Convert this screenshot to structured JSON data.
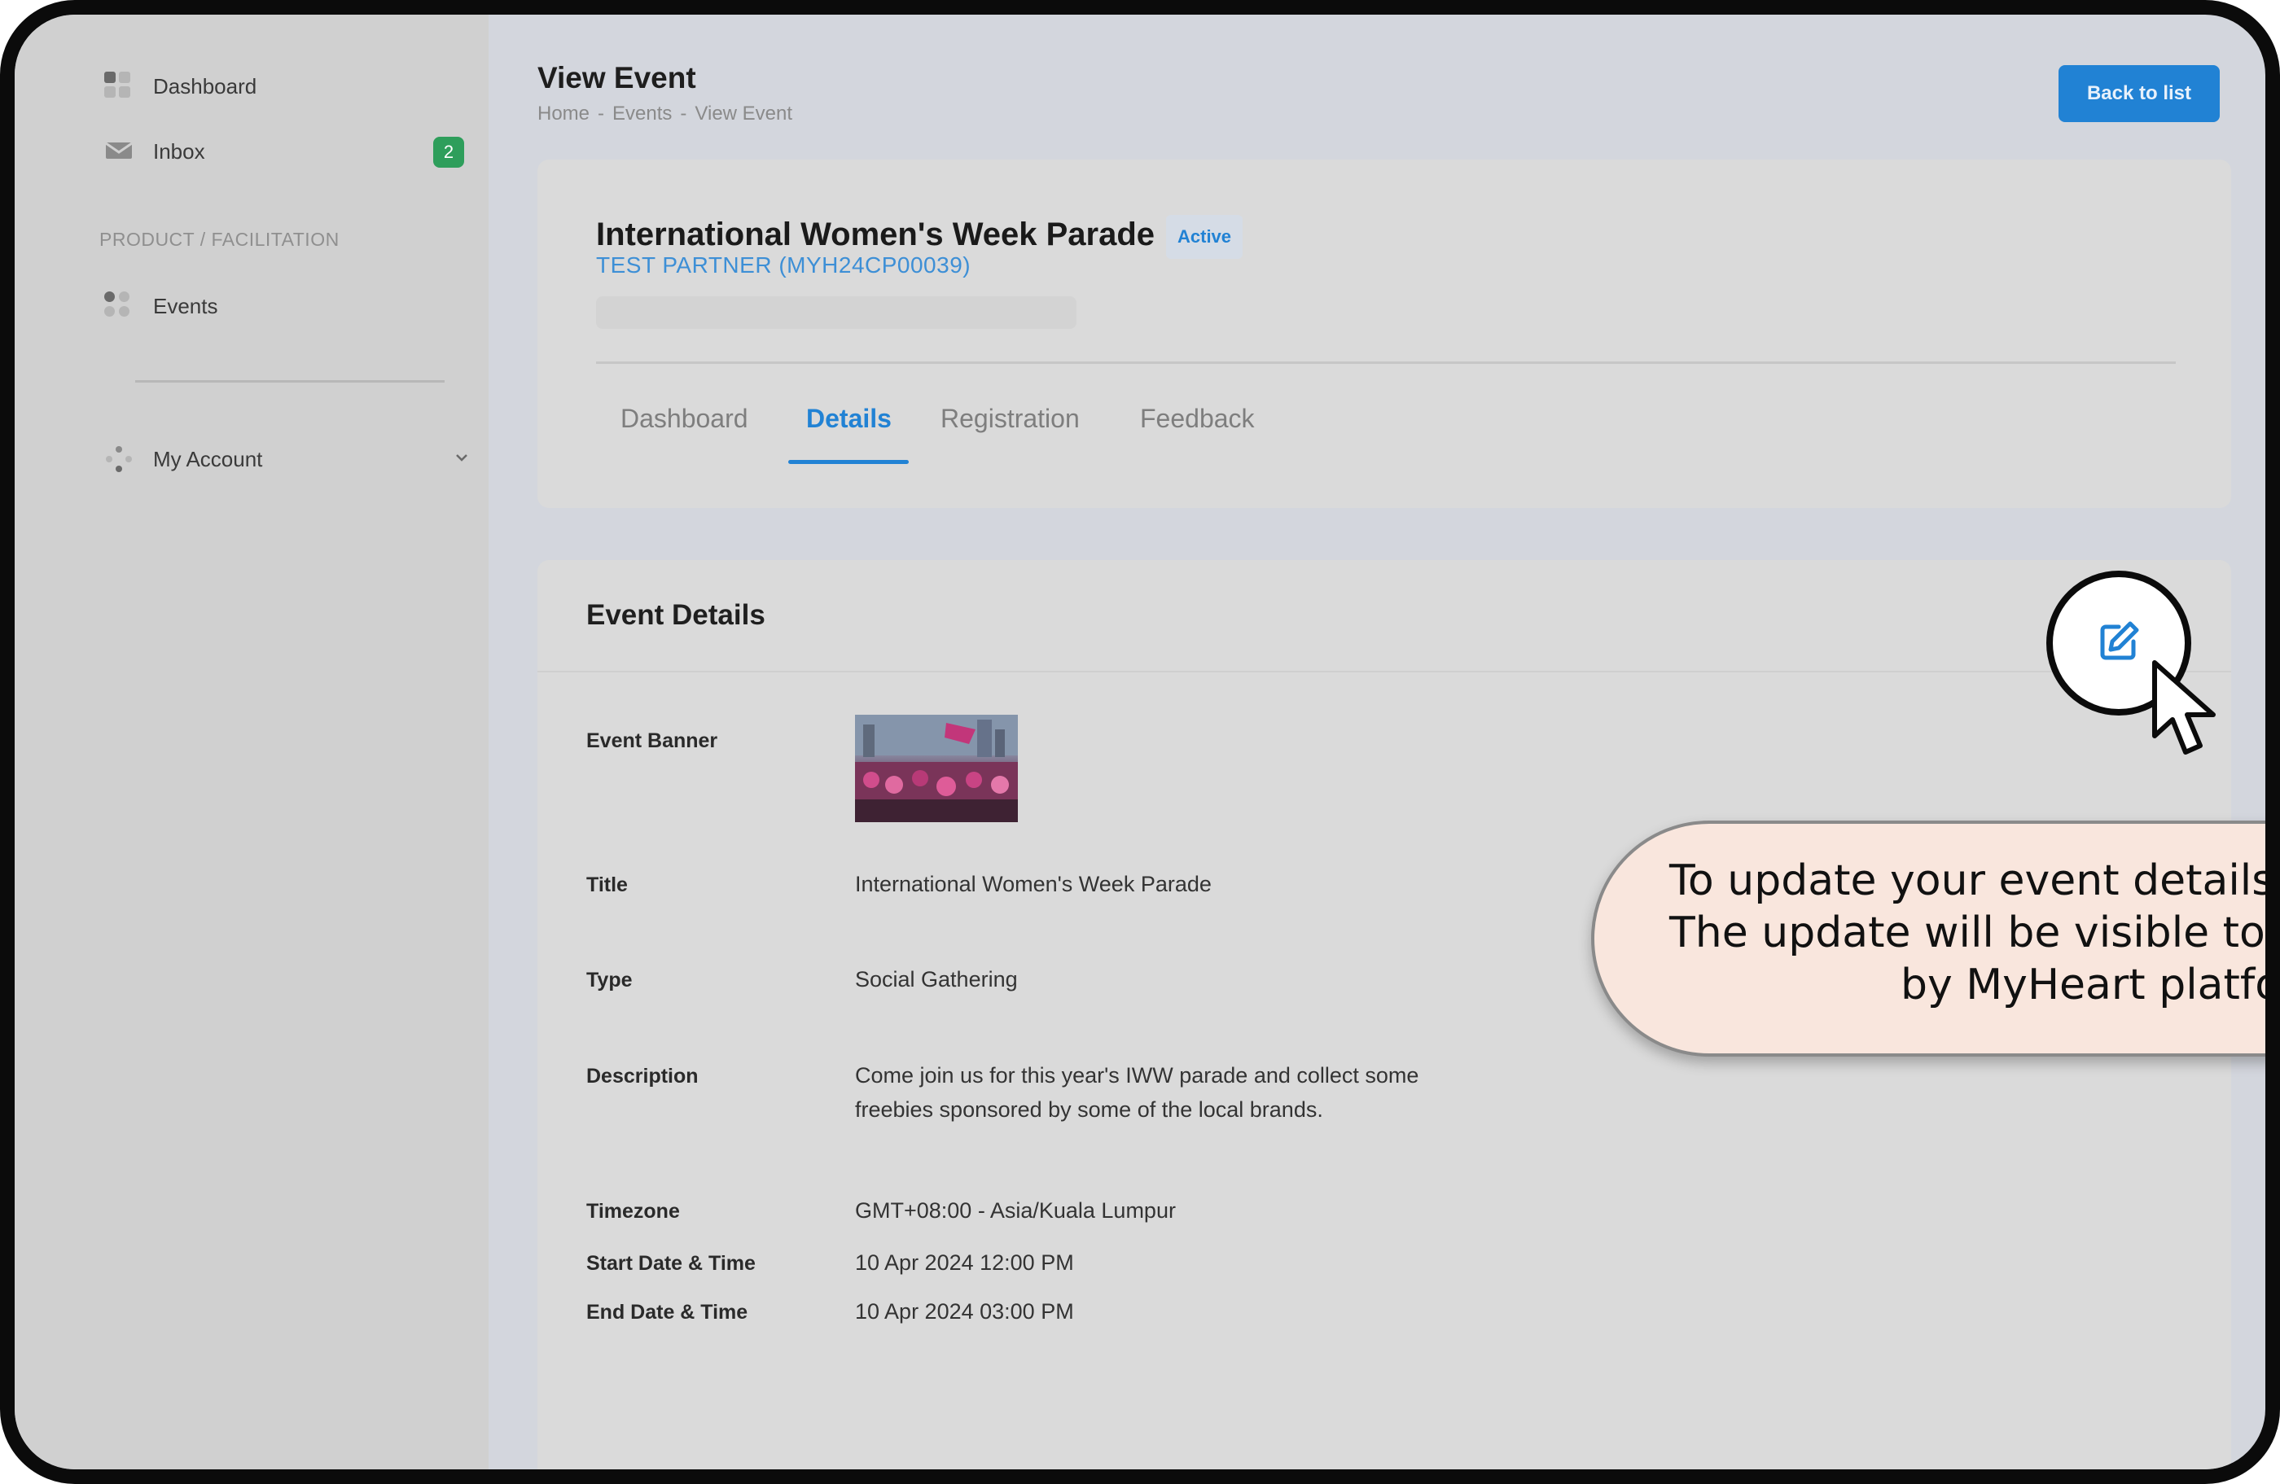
{
  "sidebar": {
    "items": [
      {
        "label": "Dashboard",
        "icon": "dashboard-grid-icon"
      },
      {
        "label": "Inbox",
        "icon": "mail-icon",
        "badge": "2"
      },
      {
        "label": "Events",
        "icon": "events-dots-icon"
      },
      {
        "label": "My Account",
        "icon": "account-icon"
      }
    ],
    "section_label": "PRODUCT / FACILITATION"
  },
  "header": {
    "title": "View Event",
    "breadcrumb": [
      "Home",
      "-",
      "Events",
      "-",
      "View Event"
    ],
    "back_button": "Back to list"
  },
  "event": {
    "name": "International Women's Week Parade",
    "status": "Active",
    "partner": "TEST PARTNER (MYH24CP00039)"
  },
  "tabs": [
    "Dashboard",
    "Details",
    "Registration",
    "Feedback"
  ],
  "active_tab": "Details",
  "details": {
    "section_title": "Event Details",
    "fields": [
      {
        "label": "Event Banner",
        "value": ""
      },
      {
        "label": "Title",
        "value": "International Women's Week Parade"
      },
      {
        "label": "Type",
        "value": "Social Gathering"
      },
      {
        "label": "Description",
        "value": "Come join us for this year's IWW parade and collect some freebies sponsored by some of the local brands."
      },
      {
        "label": "Timezone",
        "value": "GMT+08:00 - Asia/Kuala Lumpur"
      },
      {
        "label": "Start Date & Time",
        "value": "10 Apr 2024 12:00 PM"
      },
      {
        "label": "End Date & Time",
        "value": "10 Apr 2024 03:00 PM"
      }
    ]
  },
  "tooltip": {
    "lines": [
      "To update your event details,",
      "The update will be visible to p",
      "by MyHeart platfor"
    ]
  },
  "colors": {
    "accent": "#2182d4",
    "badge_green": "#2e9e5b",
    "tooltip_bg": "#f9e6dd"
  }
}
